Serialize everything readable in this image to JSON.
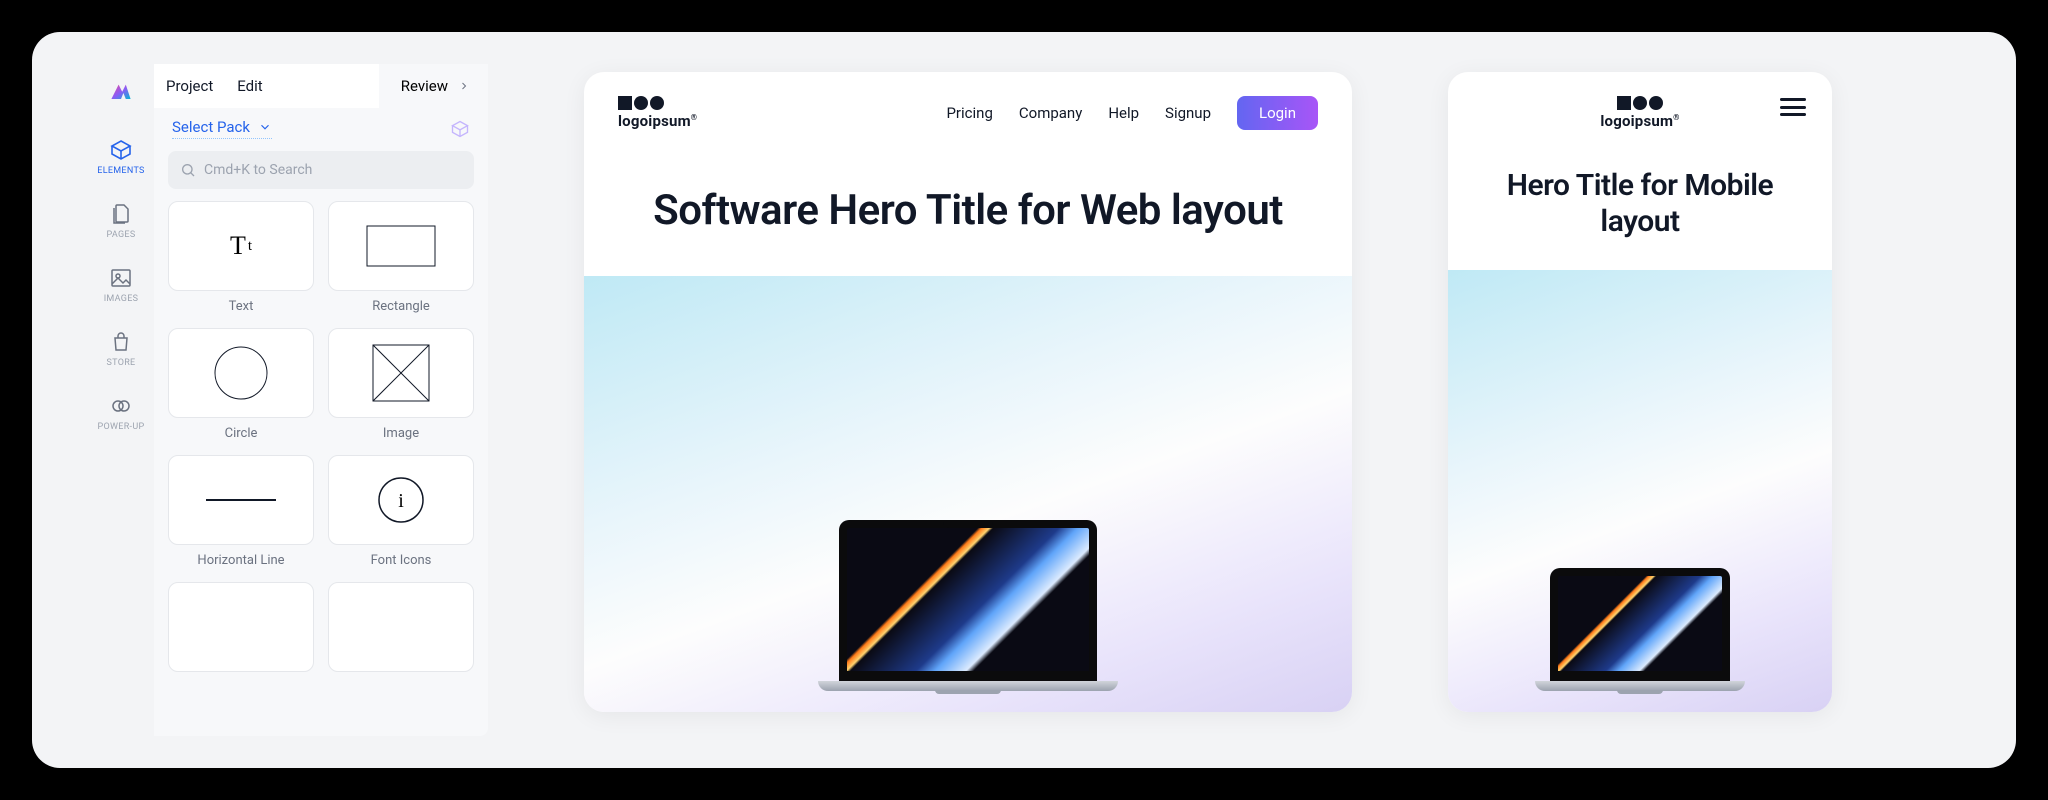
{
  "menubar": {
    "project": "Project",
    "edit": "Edit",
    "review": "Review"
  },
  "rail": {
    "items": [
      {
        "label": "ELEMENTS"
      },
      {
        "label": "PAGES"
      },
      {
        "label": "IMAGES"
      },
      {
        "label": "STORE"
      },
      {
        "label": "POWER-UP"
      }
    ]
  },
  "panel": {
    "select_pack": "Select Pack",
    "search_placeholder": "Cmd+K to Search"
  },
  "elements": {
    "text": "Text",
    "rectangle": "Rectangle",
    "circle": "Circle",
    "image": "Image",
    "hline": "Horizontal Line",
    "font_icons": "Font Icons"
  },
  "preview": {
    "brand": "logoipsum",
    "nav": {
      "pricing": "Pricing",
      "company": "Company",
      "help": "Help",
      "signup": "Signup",
      "login": "Login"
    },
    "hero_web": "Software Hero Title for Web layout",
    "hero_mobile": "Hero Title for Mobile layout"
  }
}
